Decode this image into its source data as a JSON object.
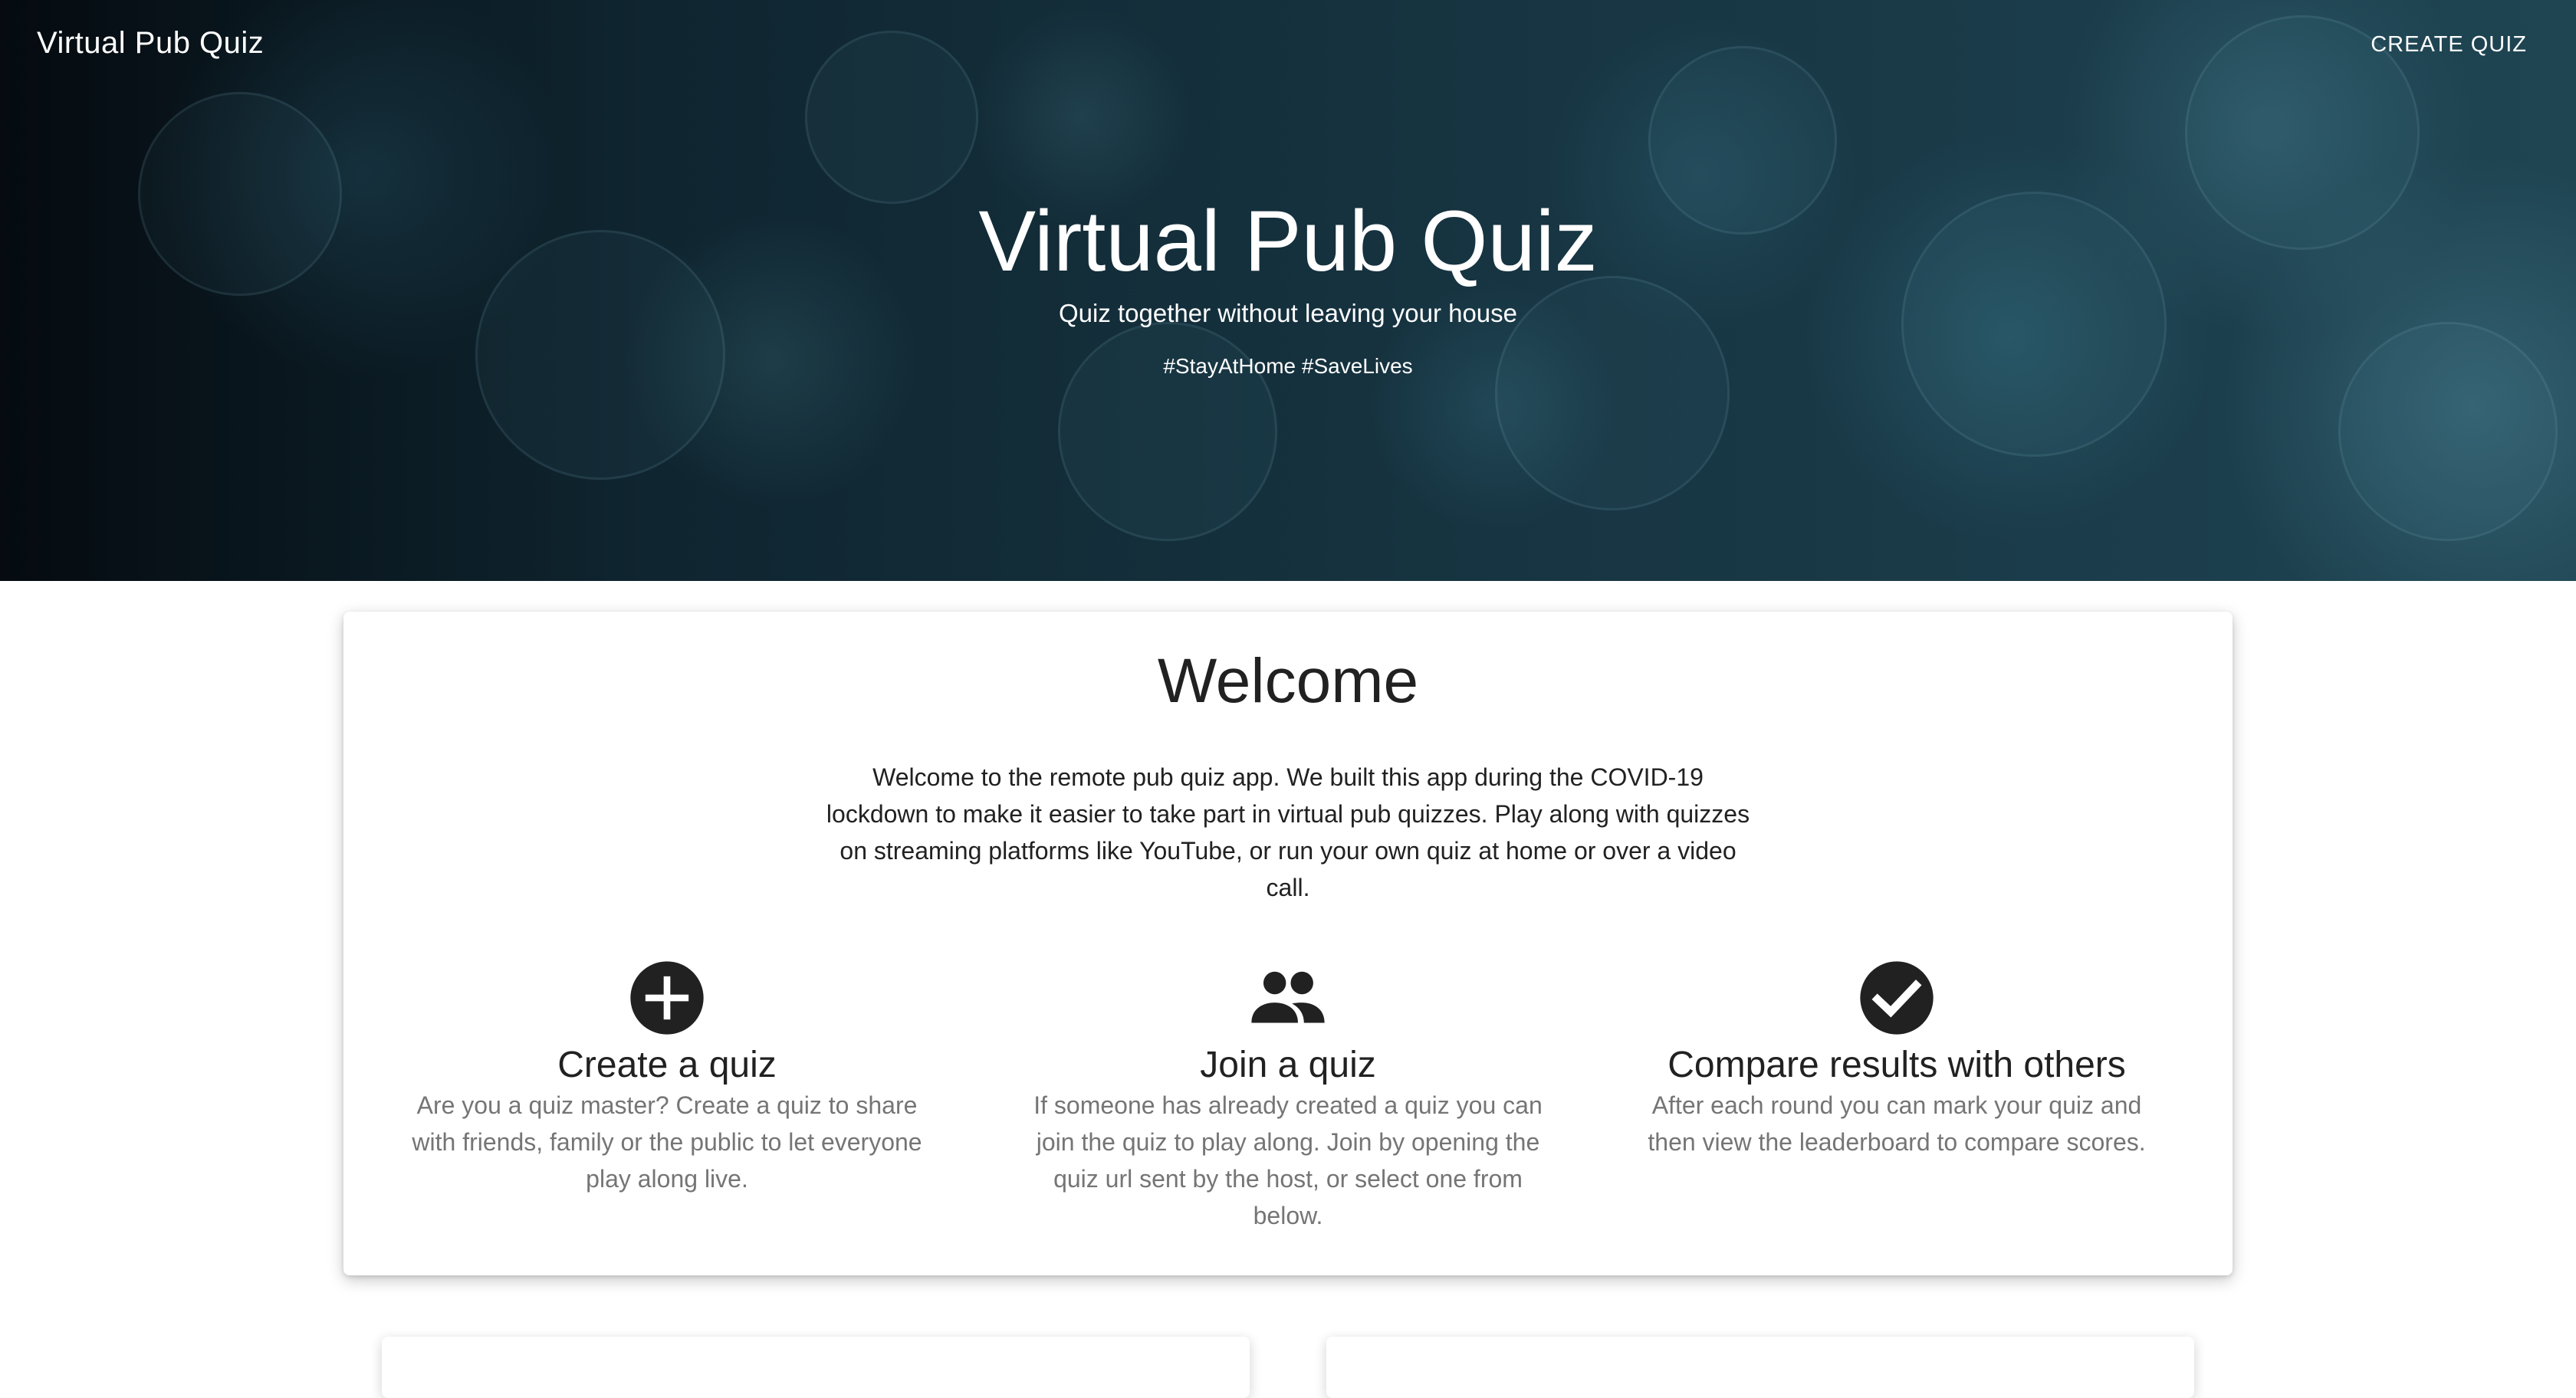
{
  "navbar": {
    "brand": "Virtual Pub Quiz",
    "create_quiz": "CREATE QUIZ"
  },
  "hero": {
    "title": "Virtual Pub Quiz",
    "subtitle": "Quiz together without leaving your house",
    "hashtags": "#StayAtHome #SaveLives"
  },
  "welcome": {
    "title": "Welcome",
    "text": "Welcome to the remote pub quiz app. We built this app during the COVID-19 lockdown to make it easier to take part in virtual pub quizzes. Play along with quizzes on streaming platforms like YouTube, or run your own quiz at home or over a video call."
  },
  "features": [
    {
      "icon": "add-circle-icon",
      "title": "Create a quiz",
      "description": "Are you a quiz master? Create a quiz to share with friends, family or the public to let everyone play along live."
    },
    {
      "icon": "people-icon",
      "title": "Join a quiz",
      "description": "If someone has already created a quiz you can join the quiz to play along. Join by opening the quiz url sent by the host, or select one from below."
    },
    {
      "icon": "check-circle-icon",
      "title": "Compare results with others",
      "description": "After each round you can mark your quiz and then view the leaderboard to compare scores."
    }
  ],
  "colors": {
    "icon": "#212121",
    "text_primary": "#212121",
    "text_secondary": "#757575",
    "hero_dark": "#0f2530"
  }
}
